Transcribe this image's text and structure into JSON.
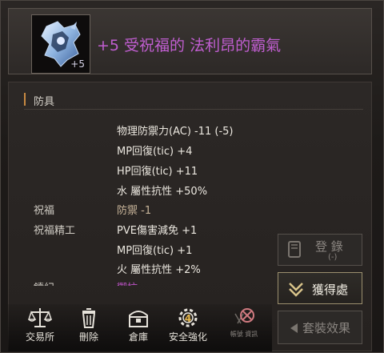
{
  "header": {
    "enhance_badge": "+5",
    "item_name": "+5 受祝福的 法利昂的霸氣"
  },
  "section": {
    "title": "防具"
  },
  "stats": {
    "lines": [
      "物理防禦力(AC) -11 (-5)",
      "MP回復(tic) +4",
      "HP回復(tic) +11",
      "水 屬性抗性 +50%"
    ],
    "blessing_label": "祝福",
    "blessing_value": "防禦 -1",
    "refine_label": "祝福精工",
    "refine_lines": [
      "PVE傷害減免 +1",
      "MP回復(tic) +1",
      "火 屬性抗性 +2%"
    ],
    "cut_label": "鑄紀",
    "cut_value": "禦抗"
  },
  "side_buttons": {
    "register": "登  錄",
    "register_sub": "(-)",
    "obtain": "獲得處",
    "set_effect": "套裝效果"
  },
  "toolbar": {
    "trade": "交易所",
    "delete": "刪除",
    "warehouse": "倉庫",
    "safe_enhance": "安全強化",
    "safe_enhance_badge": "4",
    "disabled_item": "帳號 資訊"
  },
  "colors": {
    "item_name": "#c05ed0",
    "accent_bar": "#c88a42",
    "pink_text": "#c255cc"
  }
}
